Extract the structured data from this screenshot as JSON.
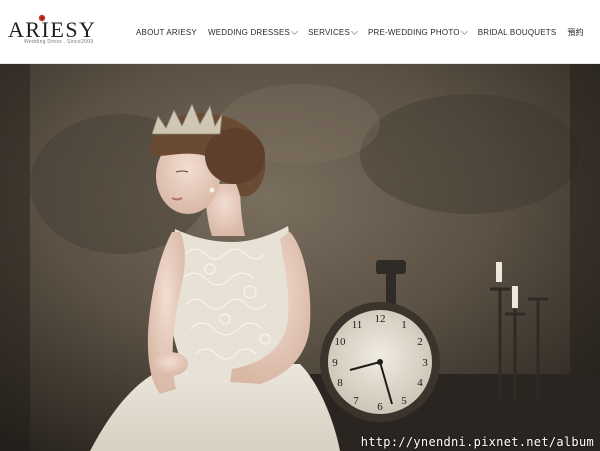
{
  "brand": {
    "name": "ARIESY",
    "tagline": "Wedding Dress . Since2009"
  },
  "nav": {
    "items": [
      {
        "label": "ABOUT ARIESY",
        "dropdown": false
      },
      {
        "label": "WEDDING DRESSES",
        "dropdown": true
      },
      {
        "label": "SERVICES",
        "dropdown": true
      },
      {
        "label": "PRE-WEDDING PHOTO",
        "dropdown": true
      },
      {
        "label": "BRIDAL BOUQUETS",
        "dropdown": false
      },
      {
        "label": "預約",
        "dropdown": false
      }
    ]
  },
  "hero": {
    "description_icon": "bride-portrait-photo",
    "watermark": "http://ynendni.pixnet.net/album"
  },
  "colors": {
    "accent": "#c0392b",
    "header_bg": "#ffffff",
    "nav_text": "#2a2a2a"
  }
}
